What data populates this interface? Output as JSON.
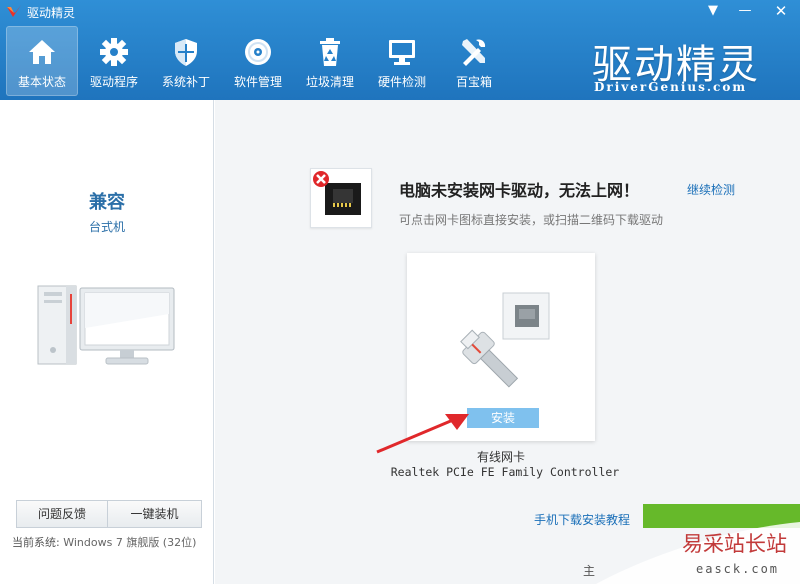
{
  "window": {
    "title": "驱动精灵",
    "menu_glyph": "▼",
    "min_glyph": "—",
    "close_glyph": "✕"
  },
  "toolbar": {
    "items": [
      {
        "label": "基本状态",
        "icon": "home-icon",
        "active": true
      },
      {
        "label": "驱动程序",
        "icon": "gear-icon"
      },
      {
        "label": "系统补丁",
        "icon": "shield-icon"
      },
      {
        "label": "软件管理",
        "icon": "disc-icon"
      },
      {
        "label": "垃圾清理",
        "icon": "recycle-bin-icon"
      },
      {
        "label": "硬件检测",
        "icon": "monitor-icon"
      },
      {
        "label": "百宝箱",
        "icon": "tools-icon"
      }
    ]
  },
  "brand": {
    "cn": "驱动精灵",
    "en": "DriverGenius.com"
  },
  "left_panel": {
    "compat_title": "兼容",
    "compat_sub": "台式机",
    "feedback_label": "问题反馈",
    "install_label": "一键装机",
    "current_system_label": "当前系统:",
    "current_system_value": "Windows 7 旗舰版 (32位)"
  },
  "main": {
    "warning_title": "电脑未安装网卡驱动，无法上网！",
    "continue_link": "继续检测",
    "warning_sub": "可点击网卡图标直接安装，或扫描二维码下载驱动",
    "card": {
      "install_button": "安装",
      "device_name": "有线网卡",
      "device_model": "Realtek PCIe FE Family Controller"
    },
    "mobile_link": "手机下载安装教程",
    "status_text": "主"
  },
  "watermark": {
    "cn": "易采站长站",
    "en": "easck.com"
  },
  "colors": {
    "header_top": "#2f8fd6",
    "header_bottom": "#1f74bd",
    "accent_link": "#1a6fb8",
    "install_button": "#7fc1ee",
    "green": "#66b92a",
    "alert_red": "#e0282b"
  }
}
